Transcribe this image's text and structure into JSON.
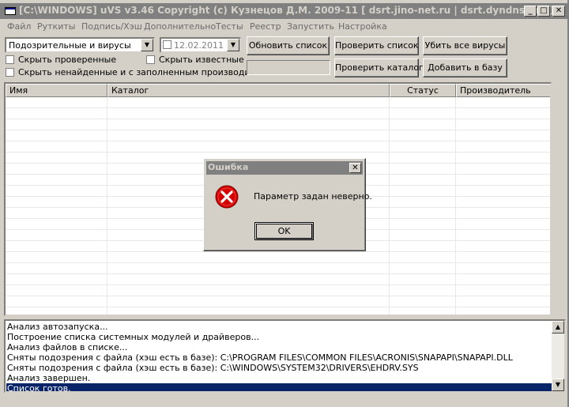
{
  "window": {
    "title": "[C:\\WINDOWS] uVS v3.46 Copyright (c) Кузнецов Д.М. 2009-11 [ dsrt.jino-net.ru | dsrt.dyndns.org ]",
    "controls": {
      "minimize": "_",
      "maximize": "□",
      "close": "✕"
    }
  },
  "menu": [
    "Файл",
    "Руткиты",
    "Подпись/Хэш",
    "Дополнительно",
    "Тесты",
    "Реестр",
    "Запустить",
    "Настройка"
  ],
  "toolbar": {
    "filter_select": "Подозрительные и вирусы",
    "date_value": "12.02.2011",
    "check_hide_checked": "Скрыть проверенные",
    "check_hide_known": "Скрыть известные",
    "check_hide_not_found": "Скрыть ненайденные и с заполненным производителем",
    "btn_refresh": "Обновить список",
    "btn_check_list": "Проверить список",
    "btn_kill_all": "Убить все вирусы",
    "btn_check_dir": "Проверить каталог",
    "btn_add_db": "Добавить в базу"
  },
  "grid": {
    "columns": [
      "Имя",
      "Каталог",
      "Статус",
      "Производитель"
    ]
  },
  "log": {
    "lines": [
      "Анализ автозапуска...",
      "Построение списка системных модулей и драйверов...",
      "Анализ файлов в списке...",
      "Сняты подозрения с файла (хэш есть в базе): C:\\PROGRAM FILES\\COMMON FILES\\ACRONIS\\SNAPAPI\\SNAPAPI.DLL",
      "Сняты подозрения с файла (хэш есть в базе): C:\\WINDOWS\\SYSTEM32\\DRIVERS\\EHDRV.SYS",
      "Анализ завершен.",
      "Список готов."
    ],
    "selected_index": 6
  },
  "dialog": {
    "title": "Ошибка",
    "message": "Параметр задан неверно.",
    "ok_label": "OK",
    "icon": "error-icon"
  },
  "colors": {
    "inactive_title": "#808080",
    "selection": "#0a246a",
    "error_red": "#d40000"
  }
}
